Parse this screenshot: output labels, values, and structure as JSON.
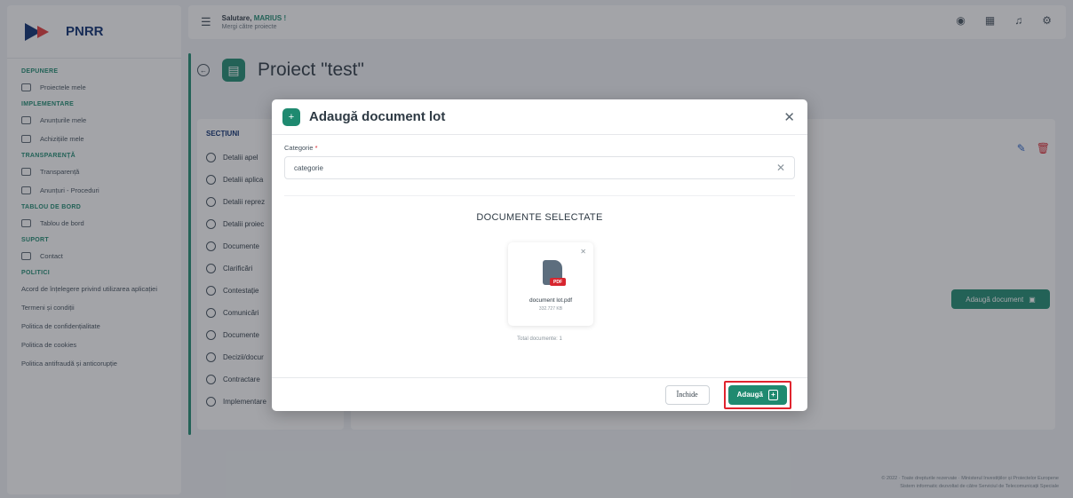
{
  "brand": {
    "name": "PNRR"
  },
  "topbar": {
    "greeting_prefix": "Salutare,",
    "user": "MARIUS !",
    "subtitle": "Mergi către proiecte"
  },
  "sidebar": {
    "sections": [
      {
        "title": "DEPUNERE",
        "items": [
          "Proiectele mele"
        ]
      },
      {
        "title": "IMPLEMENTARE",
        "items": [
          "Anunțurile mele",
          "Achizițiile mele"
        ]
      },
      {
        "title": "TRANSPARENȚĂ",
        "items": [
          "Transparență",
          "Anunțuri - Proceduri"
        ]
      },
      {
        "title": "TABLOU DE BORD",
        "items": [
          "Tablou de bord"
        ]
      },
      {
        "title": "SUPORT",
        "items": [
          "Contact"
        ]
      }
    ],
    "policies_title": "POLITICI",
    "policies": [
      "Acord de înțelegere privind utilizarea aplicației",
      "Termeni și condiții",
      "Politica de confidențialitate",
      "Politica de cookies",
      "Politica antifraudă și anticorupție"
    ]
  },
  "page": {
    "title": "Proiect \"test\""
  },
  "sections_panel": {
    "title": "SECȚIUNI",
    "items": [
      "Detalii apel",
      "Detalii aplica",
      "Detalii reprez",
      "Detalii proiec",
      "Documente",
      "Clarificări",
      "Contestație",
      "Comunicări",
      "Documente",
      "Decizii/docur",
      "Contractare",
      "Implementare"
    ]
  },
  "background_button": {
    "label": "Adaugă document"
  },
  "footer": {
    "line1": "© 2022 · Toate drepturile rezervate · Ministerul Investițiilor și Proiectelor Europene",
    "line2": "Sistem informatic dezvoltat de către Serviciul de Telecomunicații Speciale"
  },
  "modal": {
    "title": "Adaugă document lot",
    "category_label": "Categorie",
    "category_required": "*",
    "category_value": "categorie",
    "docs_heading": "DOCUMENTE SELECTATE",
    "document": {
      "name": "document lot.pdf",
      "size": "332.727 KB",
      "badge": "PDF"
    },
    "total_docs": "Total documente: 1",
    "close_label": "Închide",
    "add_label": "Adaugă"
  }
}
